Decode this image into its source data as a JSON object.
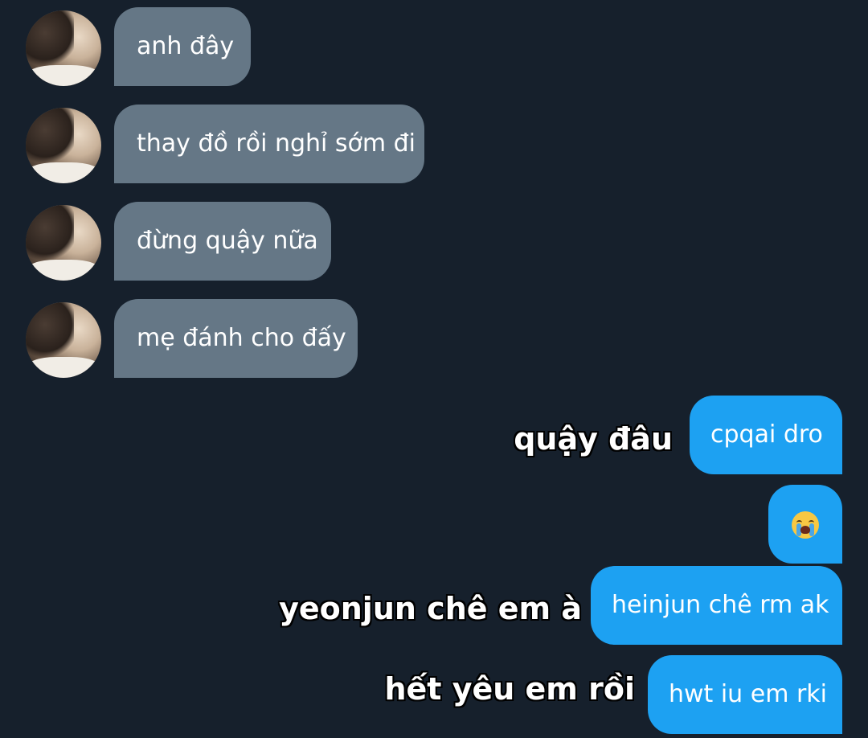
{
  "colors": {
    "background": "#16202c",
    "incoming_bubble": "#657786",
    "outgoing_bubble": "#1da1f2",
    "text": "#ffffff"
  },
  "incoming_messages": [
    {
      "text": "anh đây"
    },
    {
      "text": "thay đồ rồi nghỉ sớm đi"
    },
    {
      "text": "đừng quậy nữa"
    },
    {
      "text": "mẹ đánh cho đấy"
    }
  ],
  "outgoing_messages": [
    {
      "text": "cpqai dro",
      "caption": "quậy đâu"
    },
    {
      "emoji": "loudly-crying-face-emoji"
    },
    {
      "text": "heinjun chê rm ak",
      "caption": "yeonjun chê em à"
    },
    {
      "text": "hwt iu em rki",
      "caption": "hết yêu em rồi"
    }
  ]
}
